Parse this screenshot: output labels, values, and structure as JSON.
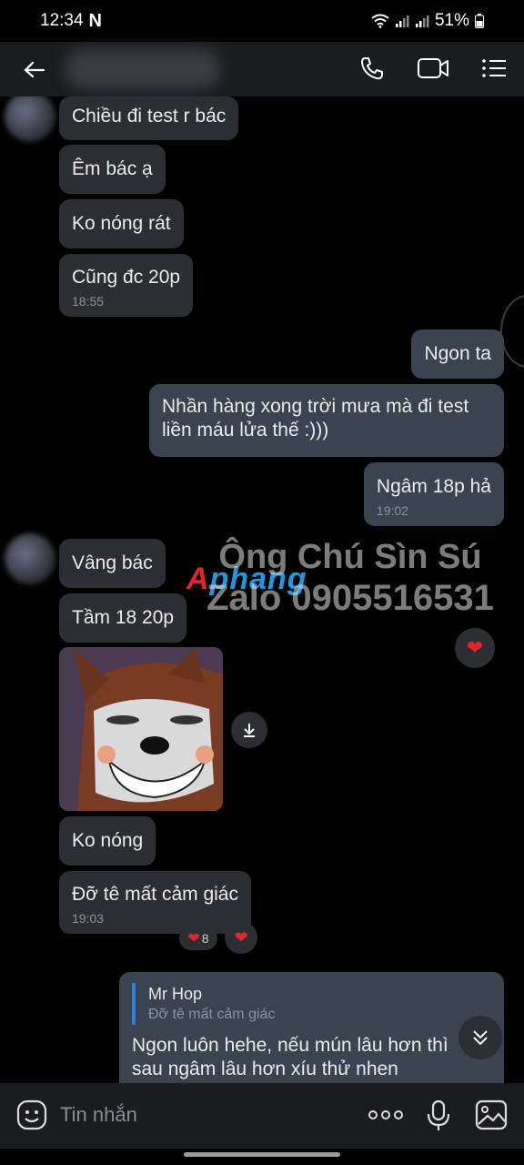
{
  "status_bar": {
    "time": "12:34",
    "battery": "51%"
  },
  "header": {},
  "messages": {
    "m1": "Chiều đi test r bác",
    "m2": "Êm bác ạ",
    "m3": "Ko nóng rát",
    "m4": "Cũng đc 20p",
    "m4_time": "18:55",
    "m5": "Ngon ta",
    "m6_line1": "Nhần hàng xong trời mưa mà đi test",
    "m6_line2": "liền máu lửa thế :)))",
    "m7": "Ngâm 18p hả",
    "m7_time": "19:02",
    "m8": "Vâng bác",
    "m9": "Tầm 18 20p",
    "m10": "Ko nóng",
    "m11": "Đỡ tê mất cảm giác",
    "m11_time": "19:03",
    "m11_reaction_count": "8"
  },
  "watermark": {
    "logo_a": "A",
    "logo_rest": "phang",
    "line1": "Ông Chú Sìn Sú",
    "line2": "Zalo 0905516531"
  },
  "reply": {
    "name": "Mr Hop",
    "quoted": "Đỡ tê mất cảm giác",
    "line1": "Ngon luôn hehe, nếu mún lâu hơn thì",
    "line2": "sau ngâm lâu hơn xíu thử nhen"
  },
  "composer": {
    "placeholder": "Tin nhắn"
  },
  "colors": {
    "incoming_bubble": "#2d2e33",
    "outgoing_bubble": "#3b4350",
    "reaction": "#e0262b"
  }
}
